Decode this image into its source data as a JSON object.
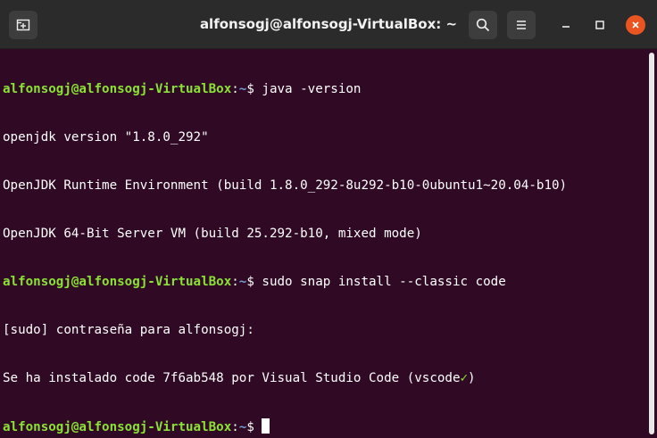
{
  "window": {
    "title": "alfonsogj@alfonsogj-VirtualBox: ~"
  },
  "titlebar": {
    "new_tab_icon": "new-tab-icon",
    "search_icon": "search-icon",
    "menu_icon": "hamburger-menu-icon",
    "minimize_icon": "minimize-icon",
    "maximize_icon": "maximize-icon",
    "close_icon": "close-icon"
  },
  "colors": {
    "background": "#300a24",
    "prompt_user": "#8ae234",
    "prompt_path": "#729fcf",
    "close_button": "#e95420"
  },
  "terminal": {
    "lines": [
      {
        "user": "alfonsogj@alfonsogj-VirtualBox",
        "sep": ":",
        "path": "~",
        "cmd": "$ java -version"
      },
      {
        "text": "openjdk version \"1.8.0_292\""
      },
      {
        "text": "OpenJDK Runtime Environment (build 1.8.0_292-8u292-b10-0ubuntu1~20.04-b10)"
      },
      {
        "text": "OpenJDK 64-Bit Server VM (build 25.292-b10, mixed mode)"
      },
      {
        "user": "alfonsogj@alfonsogj-VirtualBox",
        "sep": ":",
        "path": "~",
        "cmd": "$ sudo snap install --classic code"
      },
      {
        "text": "[sudo] contraseña para alfonsogj:"
      },
      {
        "text": "Se ha instalado code 7f6ab548 por Visual Studio Code (vscode",
        "check": "✓",
        "tail": ")"
      },
      {
        "user": "alfonsogj@alfonsogj-VirtualBox",
        "sep": ":",
        "path": "~",
        "cmd": "$ "
      }
    ]
  }
}
